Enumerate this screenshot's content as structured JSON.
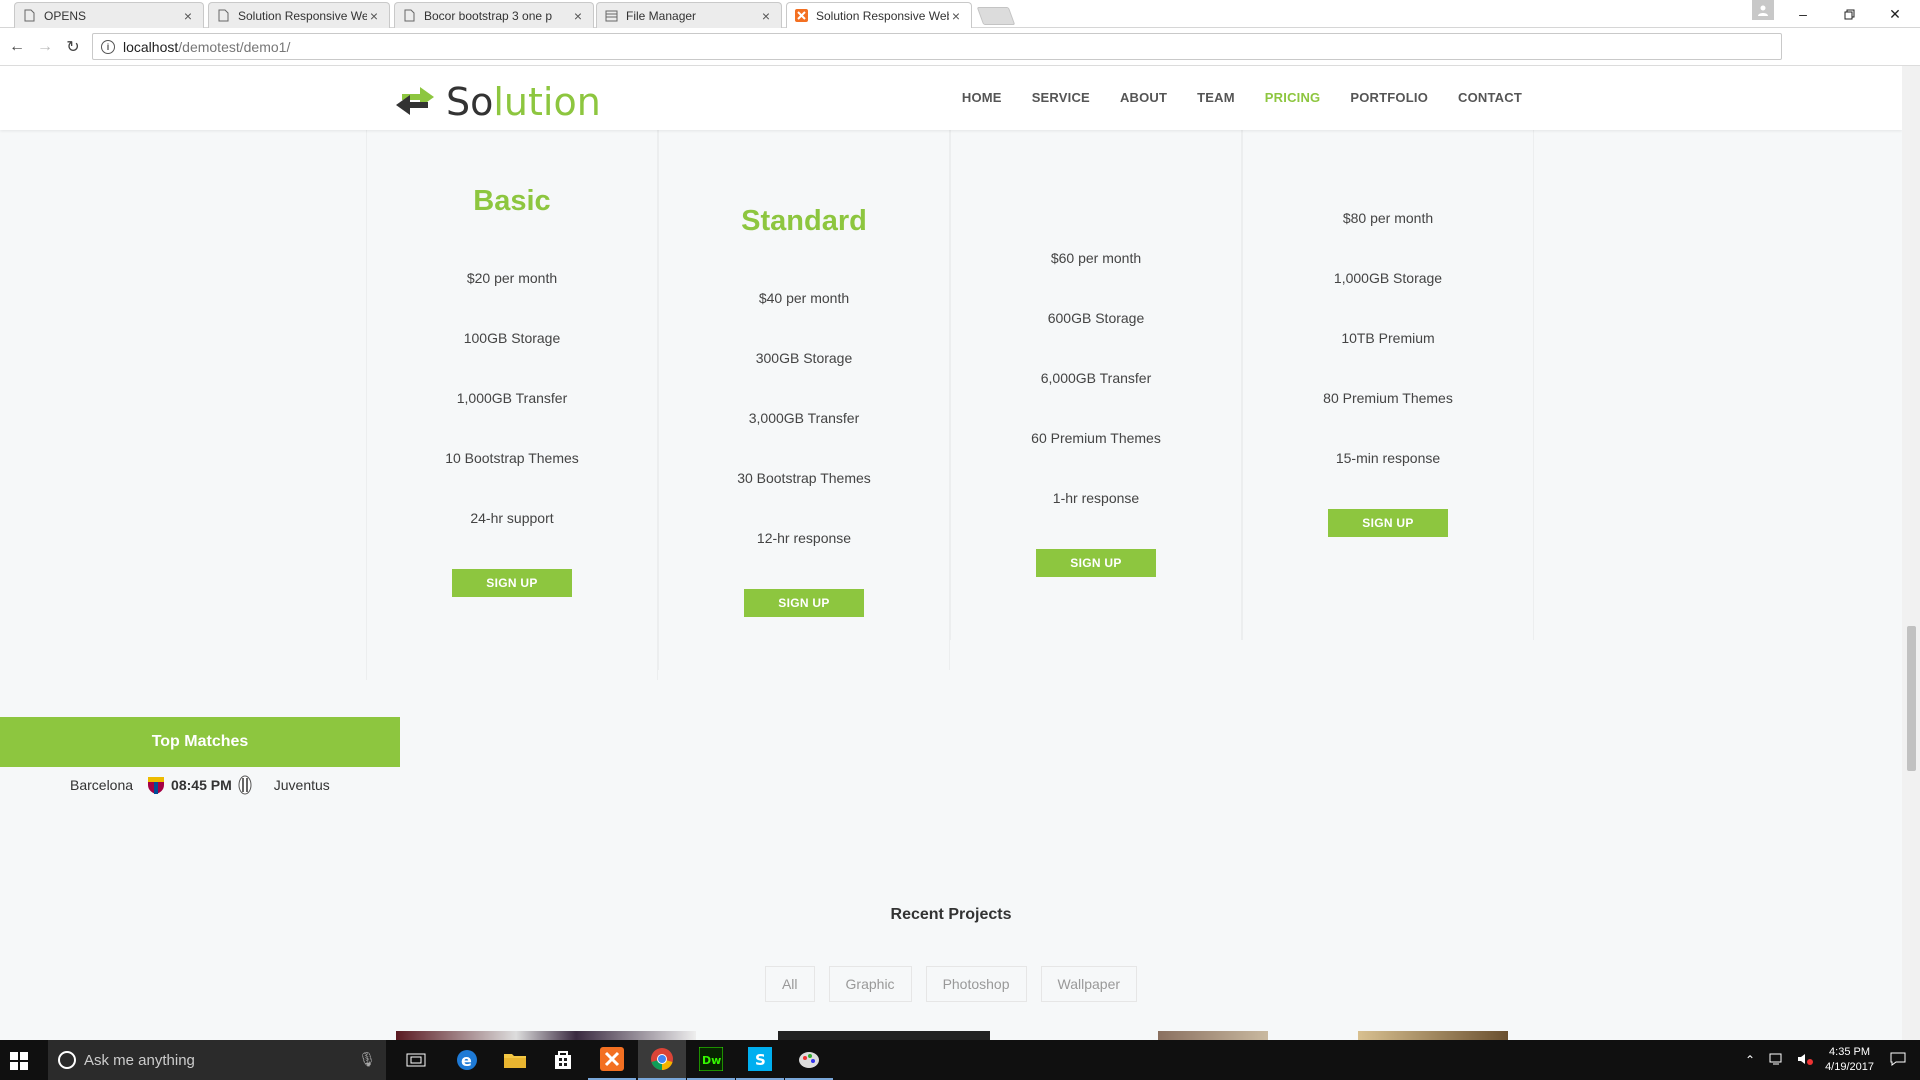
{
  "browser": {
    "tabs": [
      {
        "label": "OPENS",
        "icon": "document-icon"
      },
      {
        "label": "Solution Responsive Web",
        "icon": "document-icon"
      },
      {
        "label": "Bocor bootstrap 3 one p",
        "icon": "document-icon"
      },
      {
        "label": "File Manager",
        "icon": "file-manager-icon"
      },
      {
        "label": "Solution Responsive Web",
        "icon": "xampp-icon",
        "active": true
      }
    ],
    "url_host": "localhost",
    "url_path": "/demotest/demo1/"
  },
  "site": {
    "logo_prefix": "So",
    "logo_suffix": "lution",
    "nav": [
      "HOME",
      "SERVICE",
      "ABOUT",
      "TEAM",
      "PRICING",
      "PORTFOLIO",
      "CONTACT"
    ],
    "active_nav": "PRICING",
    "accent_color": "#8dc63f"
  },
  "pricing": {
    "plans": [
      {
        "title": "Basic",
        "features": [
          "$20 per month",
          "100GB Storage",
          "1,000GB Transfer",
          "10 Bootstrap Themes",
          "24-hr support"
        ],
        "button": "SIGN UP"
      },
      {
        "title": "Standard",
        "features": [
          "$40 per month",
          "300GB Storage",
          "3,000GB Transfer",
          "30 Bootstrap Themes",
          "12-hr response"
        ],
        "button": "SIGN UP"
      },
      {
        "title": "",
        "features": [
          "$60 per month",
          "600GB Storage",
          "6,000GB Transfer",
          "60 Premium Themes",
          "1-hr response"
        ],
        "button": "SIGN UP"
      },
      {
        "title": "",
        "features": [
          "$80 per month",
          "1,000GB Storage",
          "10TB Premium",
          "80 Premium Themes",
          "15-min response"
        ],
        "button": "SIGN UP"
      }
    ]
  },
  "matches": {
    "title": "Top Matches",
    "home": "Barcelona",
    "time": "08:45 PM",
    "away": "Juventus"
  },
  "projects": {
    "title": "Recent Projects",
    "filters": [
      "All",
      "Graphic",
      "Photoshop",
      "Wallpaper"
    ]
  },
  "taskbar": {
    "search_placeholder": "Ask me anything",
    "apps": [
      "task-view-icon",
      "edge-icon",
      "file-explorer-icon",
      "store-icon",
      "xampp-icon",
      "chrome-icon",
      "dreamweaver-icon",
      "skype-icon",
      "paint-icon"
    ],
    "time": "4:35 PM",
    "date": "4/19/2017"
  }
}
